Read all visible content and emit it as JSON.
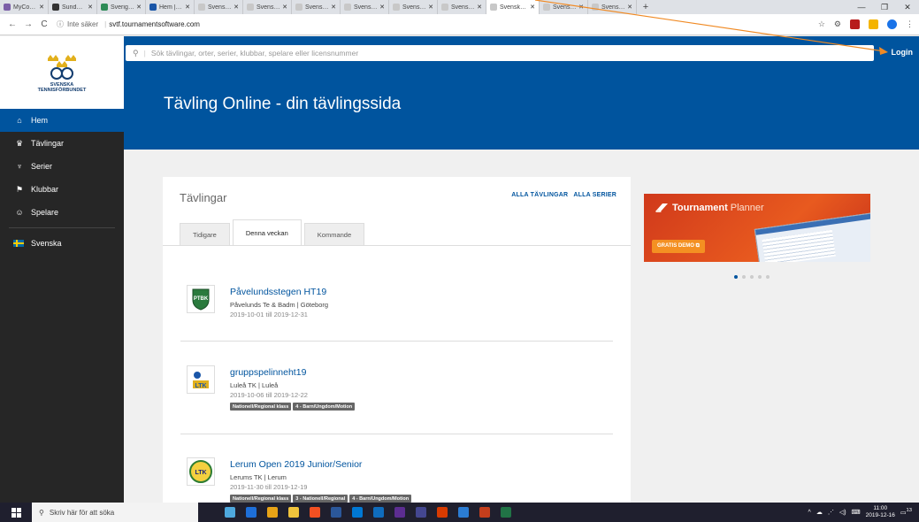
{
  "browser": {
    "tabs": [
      {
        "title": "MyCourt - Boka",
        "color": "#7b5ea7"
      },
      {
        "title": "Sundbybergs",
        "color": "#333333"
      },
      {
        "title": "Sverigeledande",
        "color": "#2e8b57"
      },
      {
        "title": "Hem | Svenska",
        "color": "#1a56a8"
      },
      {
        "title": "Svenska Tennis",
        "color": "#c8c8c8"
      },
      {
        "title": "Svenska Tennis",
        "color": "#c8c8c8"
      },
      {
        "title": "Svenska Tennis",
        "color": "#c8c8c8"
      },
      {
        "title": "Svenska Tennis",
        "color": "#c8c8c8"
      },
      {
        "title": "Svenska Tennis",
        "color": "#c8c8c8"
      },
      {
        "title": "Svenska Tennis",
        "color": "#c8c8c8"
      },
      {
        "title": "Svenska Tennis",
        "color": "#c8c8c8"
      },
      {
        "title": "Svenska Tennis",
        "color": "#c8c8c8"
      },
      {
        "title": "Svenska Tennis",
        "color": "#c8c8c8"
      }
    ],
    "active_tab": 10,
    "security_label": "Inte säker",
    "url": "svtf.tournamentsoftware.com"
  },
  "brand": {
    "logo_text": "SVENSKA\nTENNISFÖRBUNDET",
    "primary": "#00549e",
    "dark": "#262626"
  },
  "sidebar": {
    "items": [
      {
        "label": "Hem",
        "icon": "home-icon",
        "glyph": "⌂",
        "active": true
      },
      {
        "label": "Tävlingar",
        "icon": "trophy-icon",
        "glyph": "♛",
        "active": false
      },
      {
        "label": "Serier",
        "icon": "cup-icon",
        "glyph": "♆",
        "active": false
      },
      {
        "label": "Klubbar",
        "icon": "flag-icon",
        "glyph": "⚑",
        "active": false
      },
      {
        "label": "Spelare",
        "icon": "players-icon",
        "glyph": "☺",
        "active": false
      }
    ],
    "language": "Svenska"
  },
  "header": {
    "search_placeholder": "Sök tävlingar, orter, serier, klubbar, spelare eller licensnummer",
    "login": "Login",
    "title": "Tävling Online - din tävlingssida"
  },
  "tournaments": {
    "title": "Tävlingar",
    "links": [
      "ALLA TÄVLINGAR",
      "ALLA SERIER"
    ],
    "tabs": [
      {
        "label": "Tidigare",
        "active": false
      },
      {
        "label": "Denna veckan",
        "active": true
      },
      {
        "label": "Kommande",
        "active": false
      }
    ],
    "events": [
      {
        "name": "Påvelundsstegen HT19",
        "org": "Påvelunds Te & Badm | Göteborg",
        "dates": "2019-10-01 till 2019-12-31",
        "logo": "PTBK",
        "badges": []
      },
      {
        "name": "gruppspelinneht19",
        "org": "Luleå TK | Luleå",
        "dates": "2019-10-06 till 2019-12-22",
        "logo": "LTK",
        "badges": [
          "Nationell/Regional klass",
          "4 - Barn/Ungdom/Motion"
        ]
      },
      {
        "name": "Lerum Open 2019 Junior/Senior",
        "org": "Lerums TK | Lerum",
        "dates": "2019-11-30 till 2019-12-19",
        "logo": "LTK",
        "badges": [
          "Nationell/Regional klass",
          "3 - Nationell/Regional",
          "4 - Barn/Ungdom/Motion"
        ]
      }
    ]
  },
  "ad": {
    "title_bold": "Tournament",
    "title_light": "Planner",
    "button": "GRATIS DEMO",
    "dots": 5,
    "active_dot": 0
  },
  "taskbar": {
    "search": "Skriv här för att söka",
    "time": "11:00",
    "date": "2019-12-16",
    "notifications": "13",
    "apps": [
      "#4ea8de",
      "#1e6fd9",
      "#e8a317",
      "#f0c33c",
      "#f25022",
      "#2b579a",
      "#0078d4",
      "#0f6cbd",
      "#5c2d91",
      "#444791",
      "#d83b01",
      "#2b7cd3",
      "#c43e1c",
      "#217346"
    ]
  }
}
